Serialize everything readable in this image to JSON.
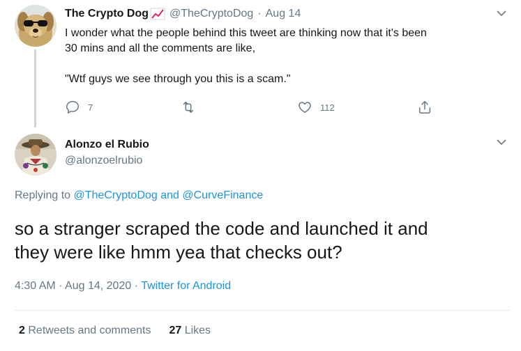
{
  "parent_tweet": {
    "display_name": "The Crypto Dog",
    "handle": "@TheCryptoDog",
    "separator": "·",
    "date": "Aug 14",
    "text_lines": [
      "I wonder what the people behind this tweet are thinking now that it's been",
      "30 mins and all the comments are like,"
    ],
    "text_quote": "\"Wtf guys we see through you this is a scam.\"",
    "reply_count": "7",
    "retweet_count": "",
    "like_count": "112"
  },
  "reply_tweet": {
    "display_name": "Alonzo el Rubio",
    "handle": "@alonzoelrubio",
    "replying_prefix": "Replying to",
    "replying_user1": "@TheCryptoDog",
    "replying_and": "and",
    "replying_user2": "@CurveFinance",
    "text_line1": "so a stranger scraped the code and launched it and",
    "text_line2": "they were like hmm yea that checks out?",
    "time": "4:30 AM",
    "separator": "·",
    "date": "Aug 14, 2020",
    "source": "Twitter for Android",
    "retweets_count": "2",
    "retweets_label": "Retweets and comments",
    "likes_count": "27",
    "likes_label": "Likes"
  },
  "colors": {
    "link": "#1b95e0",
    "secondary_text": "#657786",
    "primary_text": "#14171a",
    "divider": "#e6ecf0",
    "thread_line": "#ccd6dd"
  }
}
